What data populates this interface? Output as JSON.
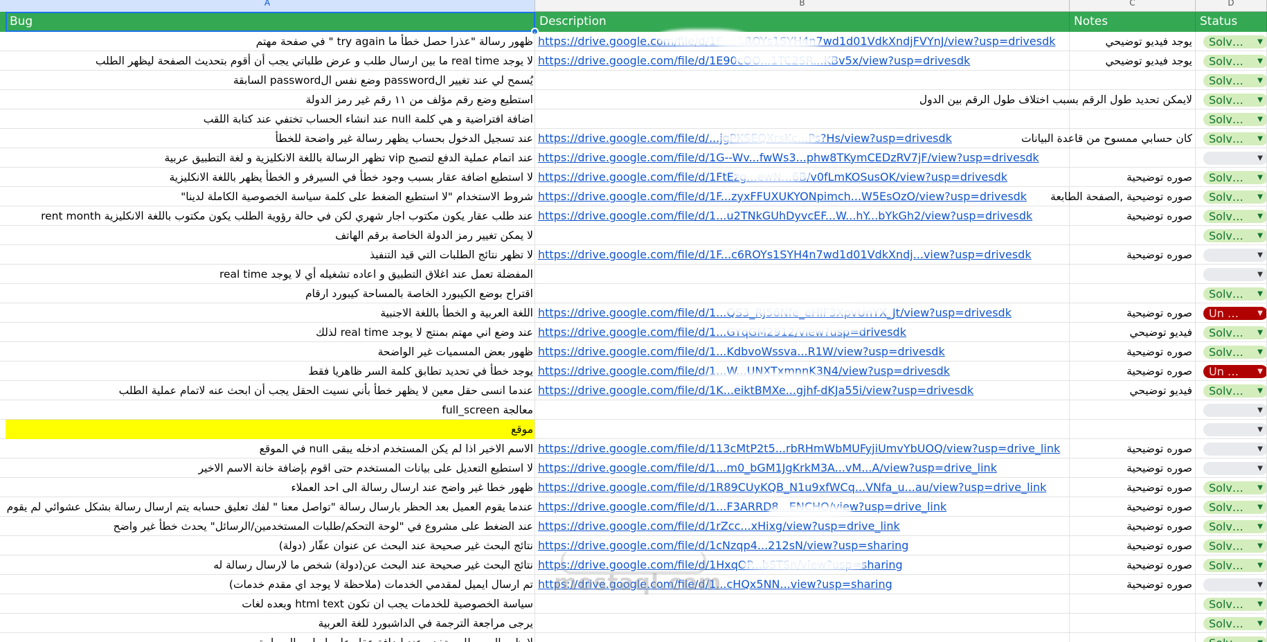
{
  "sheet": {
    "column_letters": [
      "A",
      "B",
      "C",
      "D"
    ],
    "headers": {
      "bug": "Bug",
      "description": "Description",
      "notes": "Notes",
      "status": "Status"
    },
    "rows": [
      {
        "bug": "ظهور رسالة \"عذرا حصل خطأ ما try again \" في صفحة مهتم",
        "link": "https://drive.google.com/file/d/1F...c6ROYs1SYH4n7wd1d01VdkXndjFVYnJ/view?usp=drivesdk",
        "note": "يوجد فيديو توضيحي",
        "status": "Solv…",
        "status_type": "solved"
      },
      {
        "bug": "لا يوجد real time ما بين ارسال طلب و عرض طلباتي يجب أن أقوم بتحديث الصفحة ليظهر الطلب",
        "link": "https://drive.google.com/file/d/1E90cOO...1TC2SR...KBv5x/view?usp=drivesdk",
        "note": "يوجد فيديو توضيحي",
        "status": "Solv…",
        "status_type": "solved"
      },
      {
        "bug": "يُسمح لي عند تغيير الpassword وضع نفس الpassword السابقة",
        "link": "",
        "note": "",
        "status": "Solv…",
        "status_type": "solved"
      },
      {
        "bug": "استطيع وضع رقم مؤلف من ١١ رقم غير رمز الدولة",
        "link": "",
        "note": "لايمكن تحديد طول الرقم بسبب اختلاف طول الرقم بين الدول",
        "status": "Solv…",
        "status_type": "solved"
      },
      {
        "bug": "اضافة افتراضية و هي كلمة null عند انشاء الحساب تختفي عند كتابة اللقب",
        "link": "",
        "note": "",
        "status": "Solv…",
        "status_type": "solved"
      },
      {
        "bug": "عند تسجيل الدخول بحساب يظهر رسالة غير واضحة للخطأ",
        "link": "https://drive.google.com/file/d/...jgPKSEQXrsKc...Ps?Hs/view?usp=drivesdk",
        "note": "كان حسابي ممسوح من قاعدة البيانات",
        "status": "Solv…",
        "status_type": "solved"
      },
      {
        "bug": "عند اتمام عملية الدفع لتصبح vip تظهر الرسالة باللغة الانكليزية و لغة التطبيق عربية",
        "link": "https://drive.google.com/file/d/1G--Wv...fwWs3...phw8TKymCEDzRV7jF/view?usp=drivesdk",
        "note": "",
        "status": "",
        "status_type": "empty"
      },
      {
        "bug": "لا استطيع اضافة عقار بسبب وجود خطأ في السيرفر و الخطأ يظهر باللغة الانكليزية",
        "link": "https://drive.google.com/file/d/1FtEzg...ewN...6B/v0fLmKOSusOK/view?usp=drivesdk",
        "note": "صوره توضيحية",
        "status": "Solv…",
        "status_type": "solved"
      },
      {
        "bug": "شروط الاستخدام \"لا استطيع الضغط على كلمة سياسة الخصوصية الكاملة لدينا\"",
        "link": "https://drive.google.com/file/d/1F...zyxFFUXUKYONpimch...W5EsOzO/view?usp=drivesdk",
        "note": "صوره توضيحية ,الصفحة الطابعة",
        "status": "Solv…",
        "status_type": "solved"
      },
      {
        "bug": "عند طلب عقار يكون مكتوب اجار شهري لكن في حالة رؤوية الطلب يكون مكتوب باللغة الانكليزية rent month",
        "link": "https://drive.google.com/file/d/1...u2TNkGUhDyvcEF...W...hY...bYkGh2/view?usp=drivesdk",
        "note": "صوره توضيحية",
        "status": "Solv…",
        "status_type": "solved"
      },
      {
        "bug": "لا يمكن تغيير رمز الدولة الخاصة برقم الهاتف",
        "link": "",
        "note": "",
        "status": "Solv…",
        "status_type": "solved"
      },
      {
        "bug": "لا تظهر نتائج الطلبات التي قيد التنفيذ",
        "link": "https://drive.google.com/file/d/1F...c6ROYs1SYH4n7wd1d01VdkXndj...view?usp=drivesdk",
        "note": "صوره توضيحية",
        "status": "",
        "status_type": "empty"
      },
      {
        "bug": "المفضلة تعمل عند اغلاق التطبيق و اعاده تشغيله أي لا يوجد real time",
        "link": "",
        "note": "",
        "status": "",
        "status_type": "empty"
      },
      {
        "bug": "اقتراح بوضع الكيبورد الخاصة بالمساحة كيبورد ارقام",
        "link": "",
        "note": "",
        "status": "Solv…",
        "status_type": "solved"
      },
      {
        "bug": "اللغة العربية و الخطأ باللغة الاجنبية",
        "link": "https://drive.google.com/file/d/1...QS3_RJ56Nfe_eHlF3XpvUnYX_Jt/view?usp=drivesdk",
        "note": "صوره توضيحية",
        "status": "Un …",
        "status_type": "unsolved"
      },
      {
        "bug": "عند وضع اني مهتم بمنتج لا يوجد real time لذلك",
        "link": "https://drive.google.com/file/d/1...GYqGM2912/view?usp=drivesdk",
        "note": "فيديو توضيحي",
        "status": "Solv…",
        "status_type": "solved"
      },
      {
        "bug": "ظهور بعض المسميات غير الواضحة",
        "link": "https://drive.google.com/file/d/1...KdbvoWssva...R1W/view?usp=drivesdk",
        "note": "صوره توضيحية",
        "status": "Solv…",
        "status_type": "solved"
      },
      {
        "bug": "يوجد خطأ في تحديد تطابق كلمة السر ظاهريا فقط",
        "link": "https://drive.google.com/file/d/1...W...UNXTxmnnK3N4/view?usp=drivesdk",
        "note": "صوره توضيحية",
        "status": "Un …",
        "status_type": "unsolved"
      },
      {
        "bug": "عندما انسى حقل معين لا يظهر خطأ بأني نسيت الحقل يجب أن ابحث عنه لاتمام عملية الطلب",
        "link": "https://drive.google.com/file/d/1K...eiktBMXe...gjhf-dKJa55i/view?usp=drivesdk",
        "note": "فيديو توضيحي",
        "status": "Solv…",
        "status_type": "solved"
      },
      {
        "bug": "معالجة full_screen",
        "link": "",
        "note": "",
        "status": "",
        "status_type": "empty"
      },
      {
        "bug": "موقع",
        "link": "",
        "note": "",
        "status": "",
        "status_type": "empty",
        "highlight": true
      },
      {
        "bug": "الاسم الاخير اذا لم يكن المستخدم ادخله يبقى null في الموقع",
        "link": "https://drive.google.com/file/d/113cMtP2t5...rbRHmWbMUFyjiUmvYbUOQ/view?usp=drive_link",
        "note": "صوره توضيحية",
        "status": "",
        "status_type": "empty"
      },
      {
        "bug": "لا استطيع التعديل على بيانات المستخدم حتى اقوم بإضافة خانة الاسم الاخير",
        "link": "https://drive.google.com/file/d/1...m0_bGM1JgKrkM3A...vM...A/view?usp=drive_link",
        "note": "صوره توضيحية",
        "status": "",
        "status_type": "empty"
      },
      {
        "bug": "ظهور خطا غير واضح عند ارسال رسالة الى احد العملاء",
        "link": "https://drive.google.com/file/d/1R89CUyKQB_N1u9xfWCq...VNfa_u...au/view?usp=drive_link",
        "note": "صوره توضيحية",
        "status": "Solv…",
        "status_type": "solved"
      },
      {
        "bug": "عندما يقوم العميل بعد الحظر بارسال رسالة \"تواصل معنا \" لفك تعليق حسابه يتم ارسال رسالة بشكل عشوائي لم يقوم العميل بكتابتها",
        "link": "https://drive.google.com/file/d/1...F3ARRD8...ENCHQ/view?usp=drive_link",
        "note": "صوره توضيحية",
        "status": "Solv…",
        "status_type": "solved"
      },
      {
        "bug": "عند الضغط على مشروع في \"لوحة التحكم/طلبات المستخدمين/الرسائل\" يحدث خطأ غير واضح",
        "link": "https://drive.google.com/file/d/1rZcc...xHixg/view?usp=drive_link",
        "note": "صوره توضيحية",
        "status": "Solv…",
        "status_type": "solved"
      },
      {
        "bug": "نتائج البحث غير صحيحة عند البحث عن عنوان عقّار (دولة)",
        "link": "https://drive.google.com/file/d/1cNzqp4...212sN/view?usp=sharing",
        "note": "صوره توضيحية",
        "status": "Solv…",
        "status_type": "solved"
      },
      {
        "bug": "نتائج البحث غير صحيحة عند البحث عن(دولة) شخص ما لارسال رسالة له",
        "link": "https://drive.google.com/file/d/1HxqOP...bSTSn/view?usp=sharing",
        "note": "صوره توضيحية",
        "status": "Solv…",
        "status_type": "solved"
      },
      {
        "bug": "تم ارسال ايميل لمقدمي الخدمات (ملاحظة لا يوجد اي مقدم خدمات)",
        "link": "https://drive.google.com/file/d/1...cHQx5NN...view?usp=sharing",
        "note": "صوره توضيحية",
        "status": "",
        "status_type": "empty"
      },
      {
        "bug": "سياسة الخصوصية للخدمات يجب ان تكون html text وبعده لغات",
        "link": "",
        "note": "",
        "status": "Solv…",
        "status_type": "solved"
      },
      {
        "bug": "يرجى مراجعة الترجمة في الداشبورد للغة العربية",
        "link": "",
        "note": "",
        "status": "Solv…",
        "status_type": "solved"
      },
      {
        "bug": "لايظهر السعر للمستخدم عند اضافة عقار على اساس المساحة",
        "link": "",
        "note": "",
        "status": "Solv…",
        "status_type": "solved"
      }
    ],
    "watermark": "mostaql.com",
    "colors": {
      "header_bg": "#34a853",
      "link": "#1155cc",
      "solved_bg": "#d4edbc",
      "unsolved_bg": "#b10202",
      "highlight_row": "#ffff00"
    }
  }
}
